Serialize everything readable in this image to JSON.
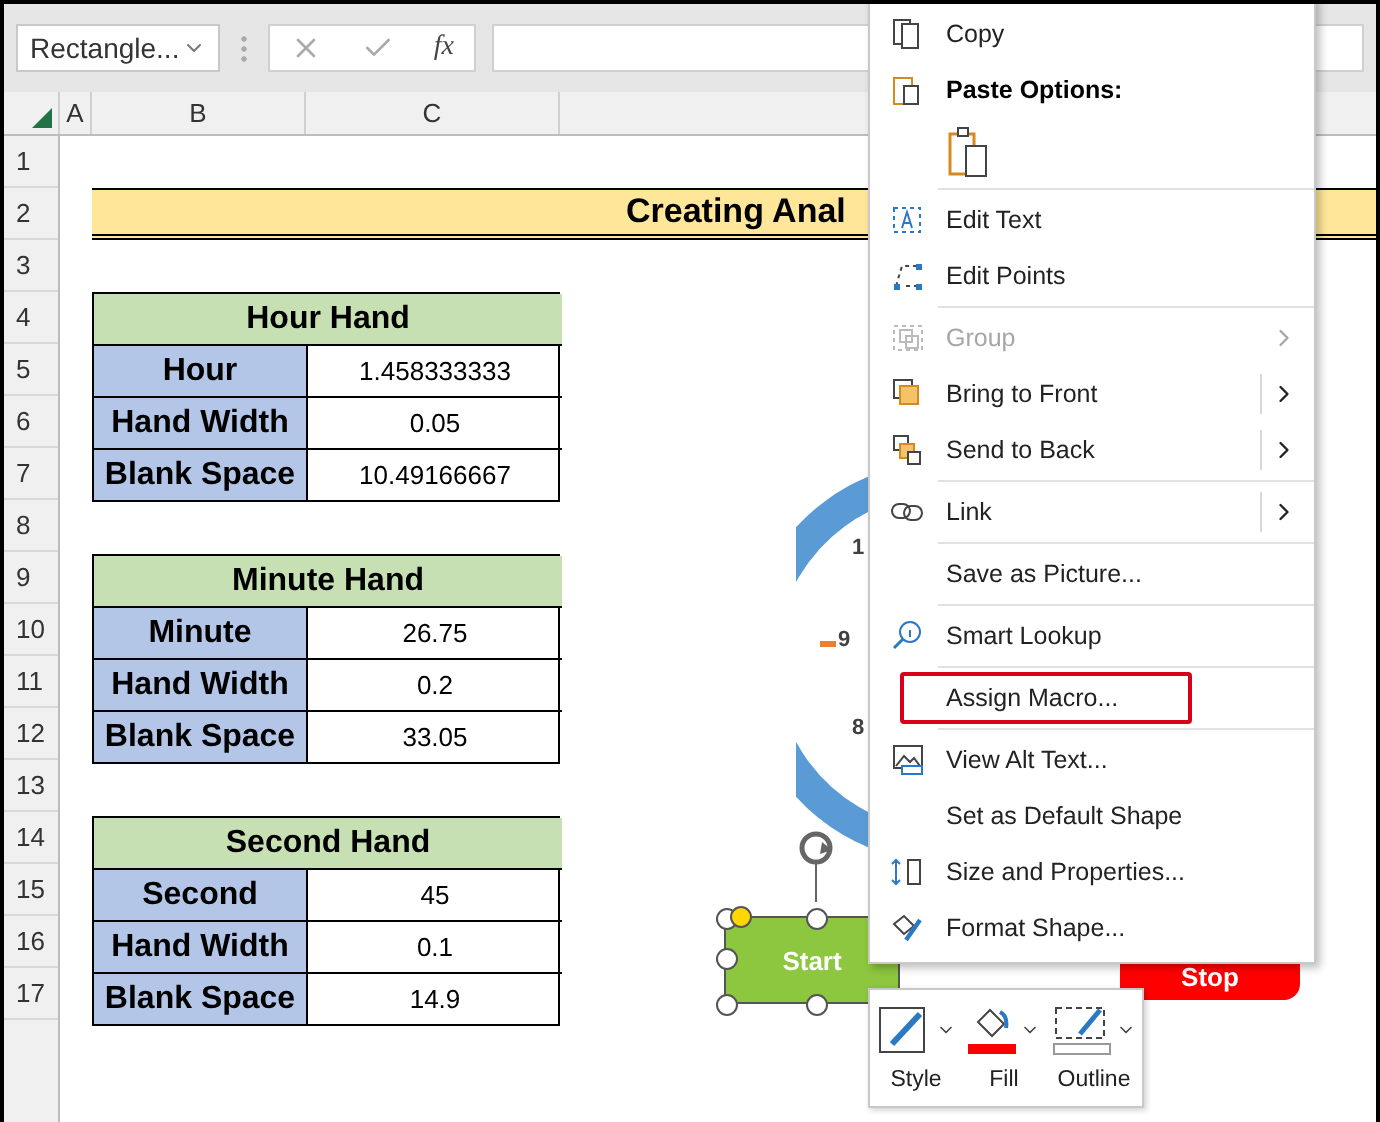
{
  "name_box": "Rectangle...",
  "formula_bar": {
    "fx": "fx"
  },
  "columns": [
    "A",
    "B",
    "C"
  ],
  "row_numbers": [
    "1",
    "2",
    "3",
    "4",
    "5",
    "6",
    "7",
    "8",
    "9",
    "10",
    "11",
    "12",
    "13",
    "14",
    "15",
    "16",
    "17"
  ],
  "title": "Creating Anal",
  "tables": [
    {
      "title": "Hour Hand",
      "rows": [
        {
          "label": "Hour",
          "value": "1.458333333"
        },
        {
          "label": "Hand Width",
          "value": "0.05"
        },
        {
          "label": "Blank Space",
          "value": "10.49166667"
        }
      ]
    },
    {
      "title": "Minute Hand",
      "rows": [
        {
          "label": "Minute",
          "value": "26.75"
        },
        {
          "label": "Hand Width",
          "value": "0.2"
        },
        {
          "label": "Blank Space",
          "value": "33.05"
        }
      ]
    },
    {
      "title": "Second Hand",
      "rows": [
        {
          "label": "Second",
          "value": "45"
        },
        {
          "label": "Hand Width",
          "value": "0.1"
        },
        {
          "label": "Blank Space",
          "value": "14.9"
        }
      ]
    }
  ],
  "clock": {
    "digits": [
      "1",
      "9",
      "8"
    ]
  },
  "start_button": {
    "label": "Start",
    "selected": true
  },
  "stop_button": {
    "label": "Stop"
  },
  "menu": {
    "items": [
      {
        "kind": "item",
        "label": "Copy"
      },
      {
        "kind": "header",
        "label": "Paste Options:"
      },
      {
        "kind": "paste-row"
      },
      {
        "kind": "separator"
      },
      {
        "kind": "item",
        "label": "Edit Text"
      },
      {
        "kind": "item",
        "label": "Edit Points"
      },
      {
        "kind": "separator"
      },
      {
        "kind": "submenu",
        "label": "Group",
        "disabled": true
      },
      {
        "kind": "split-submenu",
        "label": "Bring to Front"
      },
      {
        "kind": "split-submenu",
        "label": "Send to Back"
      },
      {
        "kind": "separator"
      },
      {
        "kind": "split-submenu",
        "label": "Link"
      },
      {
        "kind": "separator"
      },
      {
        "kind": "item",
        "label": "Save as Picture..."
      },
      {
        "kind": "separator"
      },
      {
        "kind": "item",
        "label": "Smart Lookup"
      },
      {
        "kind": "separator"
      },
      {
        "kind": "item",
        "label": "Assign Macro...",
        "annotated": true
      },
      {
        "kind": "separator"
      },
      {
        "kind": "item",
        "label": "View Alt Text..."
      },
      {
        "kind": "item",
        "label": "Set as Default Shape"
      },
      {
        "kind": "item",
        "label": "Size and Properties..."
      },
      {
        "kind": "item",
        "label": "Format Shape..."
      }
    ]
  },
  "mini_toolbar": [
    {
      "kind": "style",
      "label": "Style"
    },
    {
      "kind": "fill",
      "label": "Fill",
      "color": "#ff0000"
    },
    {
      "kind": "outline",
      "label": "Outline"
    }
  ]
}
